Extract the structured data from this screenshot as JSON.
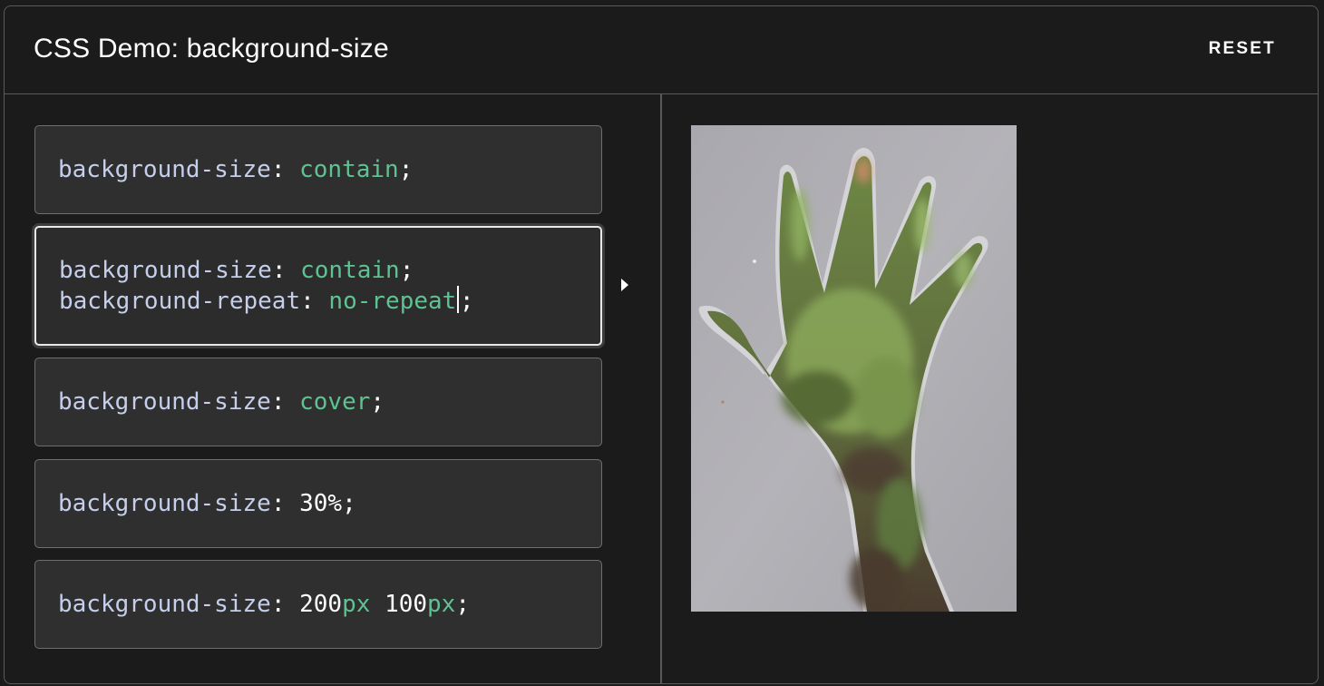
{
  "header": {
    "title": "CSS Demo: background-size",
    "reset_label": "RESET"
  },
  "colors": {
    "background": "#1b1b1b",
    "panel": "#2f2f2f",
    "border": "#5a5a5a",
    "property": "#c5cfec",
    "value": "#5fc292",
    "text": "#ffffff"
  },
  "choices": [
    {
      "lines": [
        {
          "prop": "background-size",
          "colon": ": ",
          "value": "contain",
          "semi": ";"
        }
      ]
    },
    {
      "selected": true,
      "lines": [
        {
          "prop": "background-size",
          "colon": ": ",
          "value": "contain",
          "semi": ";"
        },
        {
          "prop": "background-repeat",
          "colon": ": ",
          "value": "no-repeat",
          "semi": ";"
        }
      ]
    },
    {
      "lines": [
        {
          "prop": "background-size",
          "colon": ": ",
          "value": "cover",
          "semi": ";"
        }
      ]
    },
    {
      "lines": [
        {
          "prop": "background-size",
          "colon": ": ",
          "num": "30%",
          "semi": ";"
        }
      ]
    },
    {
      "lines": [
        {
          "prop": "background-size",
          "colon": ": ",
          "num1": "200",
          "unit1": "px",
          "space": " ",
          "num2": "100",
          "unit2": "px",
          "semi": ";"
        }
      ]
    }
  ],
  "output": {
    "image_subject": "hand-shaped cutout showing blurred green foliage"
  }
}
